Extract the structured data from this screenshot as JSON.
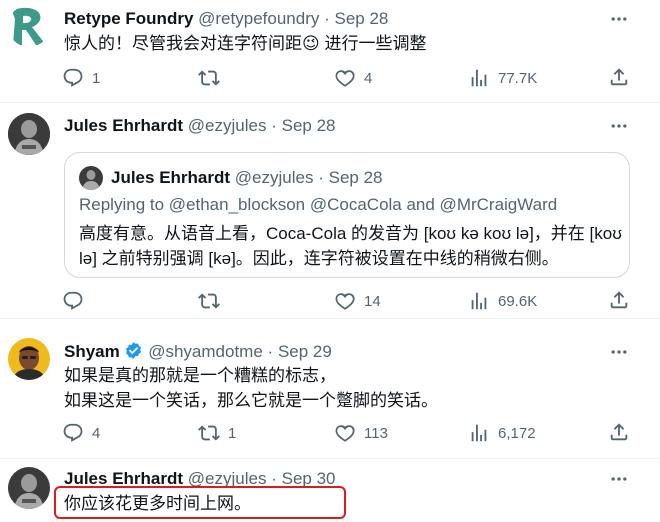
{
  "tweet1": {
    "name": "Retype Foundry",
    "handle": "@retypefoundry",
    "sep": "·",
    "date": "Sep 28",
    "text_before": "惊人的！尽管我会对连字符间距",
    "emoji": "😉",
    "text_after": " 进行一些调整",
    "replies": "1",
    "retweets": "",
    "likes": "4",
    "views": "77.7K"
  },
  "tweet2": {
    "name": "Jules Ehrhardt",
    "handle": "@ezyjules",
    "sep": "·",
    "date": "Sep 28",
    "replies": "",
    "retweets": "",
    "likes": "14",
    "views": "69.6K",
    "quote": {
      "name": "Jules Ehrhardt",
      "handle": "@ezyjules",
      "sep": "·",
      "date": "Sep 28",
      "replying": "Replying to @ethan_blockson @CocaCola and @MrCraigWard",
      "line1": "高度有意。从语音上看，Coca-Cola 的发音为 [koʊ kə koʊ lə]，并在 [koʊ",
      "line2": "lə] 之前特别强调 [kə]。因此，连字符被设置在中线的稍微右侧。"
    }
  },
  "tweet3": {
    "name": "Shyam",
    "handle": "@shyamdotme",
    "sep": "·",
    "date": "Sep 29",
    "line1": "如果是真的那就是一个糟糕的标志，",
    "line2": "如果这是一个笑话，那么它就是一个蹩脚的笑话。",
    "replies": "4",
    "retweets": "1",
    "likes": "113",
    "views": "6,172"
  },
  "tweet4": {
    "name": "Jules Ehrhardt",
    "handle": "@ezyjules",
    "sep": "·",
    "date": "Sep 30",
    "text": "你应该花更多时间上网。"
  },
  "colors": {
    "text": "#0f1419",
    "muted": "#536471",
    "verified": "#1d9bf0",
    "highlight": "#e0191b",
    "logo": "#3d9a8b"
  },
  "icons": [
    "logo-r-icon",
    "more-icon",
    "reply-icon",
    "retweet-icon",
    "like-icon",
    "views-icon",
    "share-icon",
    "verified-icon"
  ]
}
